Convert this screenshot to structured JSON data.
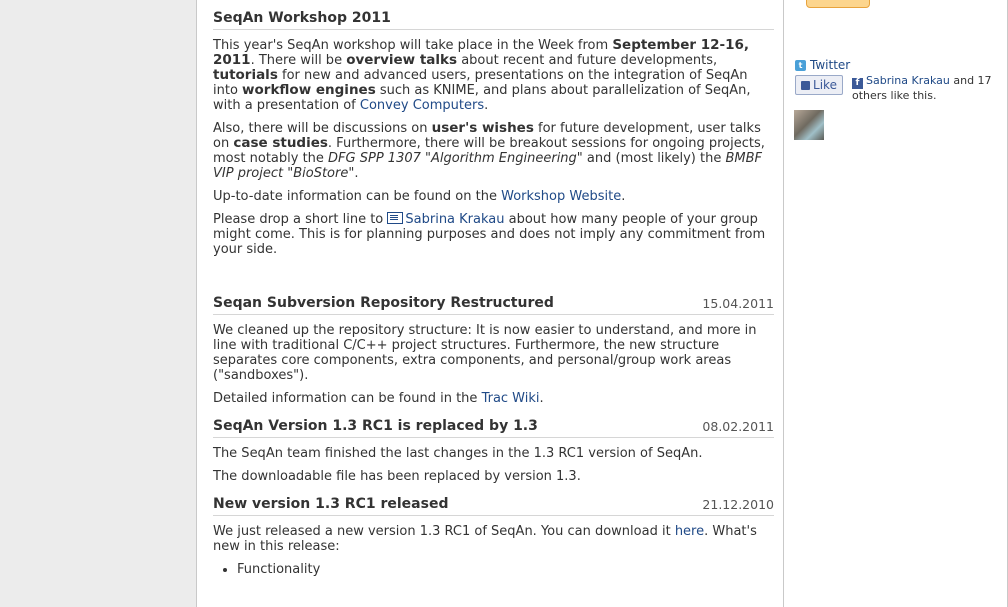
{
  "news": [
    {
      "title": "SeqAn Workshop 2011",
      "date": ""
    },
    {
      "title": "Seqan Subversion Repository Restructured",
      "date": "15.04.2011"
    },
    {
      "title": "SeqAn Version 1.3 RC1 is replaced by 1.3",
      "date": "08.02.2011"
    },
    {
      "title": "New version 1.3 RC1 released",
      "date": "21.12.2010"
    }
  ],
  "workshop": {
    "p1a": "This year's SeqAn workshop will take place in the Week from ",
    "p1b": "September 12-16, 2011",
    "p1c": ". There will be ",
    "p1d": "overview talks",
    "p1e": " about recent and future developments, ",
    "p1f": "tutorials",
    "p1g": " for new and advanced users, presentations on the integration of SeqAn into ",
    "p1h": "workflow engines",
    "p1i": " such as KNIME, and plans about parallelization of SeqAn, with a presentation of ",
    "p1link": "Convey Computers",
    "p1j": ".",
    "p2a": "Also, there will be discussions on ",
    "p2b": "user's wishes",
    "p2c": " for future development, user talks on ",
    "p2d": "case studies",
    "p2e": ". Furthermore, there will be breakout sessions for ongoing projects, most notably the ",
    "p2f": "DFG SPP 1307 \"Algorithm Engineering\"",
    "p2g": " and (most likely) the ",
    "p2h": "BMBF VIP project \"BioStore\"",
    "p2i": ".",
    "p3a": "Up-to-date information can be found on the ",
    "p3link": "Workshop Website",
    "p3b": ".",
    "p4a": "Please drop a short line to ",
    "p4link": "Sabrina Krakau",
    "p4b": " about how many people of your group might come. This is for planning purposes and does not imply any commitment from your side."
  },
  "svn": {
    "p1": "We cleaned up the repository structure: It is now easier to understand, and more in line with traditional C/C++ project structures. Furthermore, the new structure separates core components, extra components, and personal/group work areas (\"sandboxes\").",
    "p2a": "Detailed information can be found in the ",
    "p2link": "Trac Wiki",
    "p2b": "."
  },
  "v13": {
    "p1": "The SeqAn team finished the last changes in the 1.3 RC1 version of SeqAn.",
    "p2": "The downloadable file has been replaced by version 1.3."
  },
  "rc1": {
    "p1a": "We just released a new version 1.3 RC1 of SeqAn. You can download it ",
    "p1link": "here",
    "p1b": ". What's new in this release:",
    "items": [
      "Functionality"
    ]
  },
  "sidebar": {
    "twitter": "Twitter",
    "like": "Like",
    "fb_name": "Sabrina Krakau",
    "fb_rest": " and 17 others like this."
  },
  "colors": {
    "link": "#204a87",
    "facebook": "#3b5998",
    "background": "#ececec"
  }
}
